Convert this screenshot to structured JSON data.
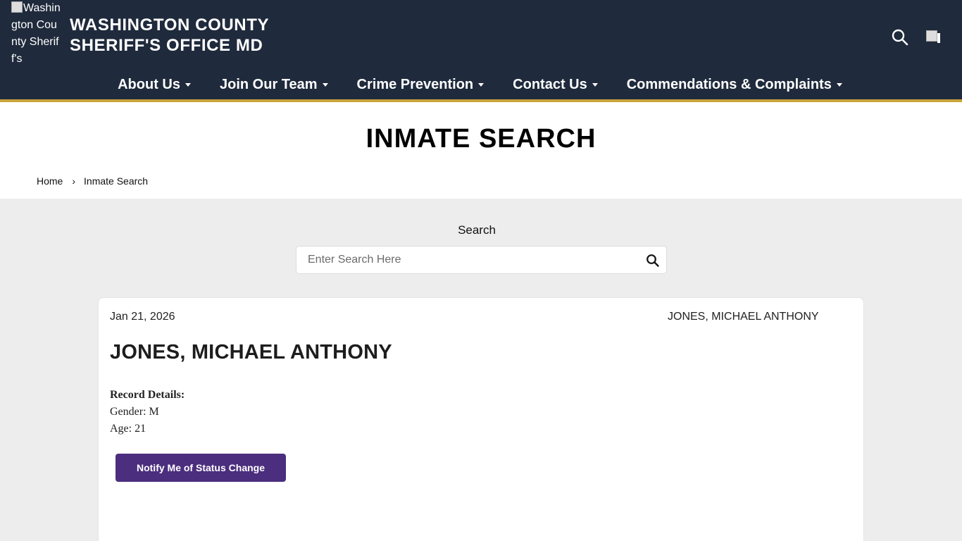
{
  "header": {
    "logo_alt": "Washington County Sheriff's",
    "title_line1": "WASHINGTON COUNTY",
    "title_line2": "SHERIFF'S OFFICE MD",
    "search_icon": "search-icon",
    "flag_icon": "broken-image-icon"
  },
  "nav": {
    "items": [
      {
        "label": "About Us"
      },
      {
        "label": "Join Our Team"
      },
      {
        "label": "Crime Prevention"
      },
      {
        "label": "Contact Us"
      },
      {
        "label": "Commendations & Complaints"
      }
    ]
  },
  "page": {
    "title": "INMATE SEARCH"
  },
  "breadcrumb": {
    "home": "Home",
    "separator": "›",
    "current": "Inmate Search"
  },
  "search": {
    "label": "Search",
    "placeholder": "Enter Search Here",
    "value": ""
  },
  "record": {
    "date": "Jan 21, 2026",
    "photo_alt": "JONES, MICHAEL ANTHONY",
    "name": "JONES, MICHAEL ANTHONY",
    "details_heading": "Record Details:",
    "gender": "Gender: M",
    "age": "Age: 21",
    "notify_button": "Notify Me of Status Change"
  },
  "colors": {
    "header_bg": "#1f2a3c",
    "accent_stripe": "#c9a43a",
    "button_bg": "#4b2e7e",
    "page_bg": "#ededed"
  }
}
